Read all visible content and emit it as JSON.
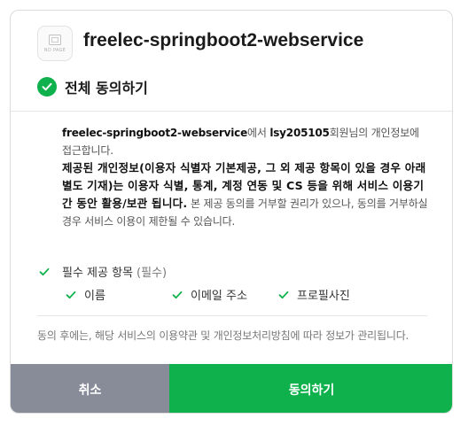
{
  "app": {
    "logo_text": "NO PAGE",
    "name": "freelec-springboot2-webservice"
  },
  "agree_all": {
    "label": "전체 동의하기",
    "checked": true
  },
  "consent": {
    "app_name": "freelec-springboot2-webservice",
    "text_1": "에서 ",
    "user_id": "lsy205105",
    "text_2": "회원님의 개인정보에 접근합니다.",
    "strong_text": "제공된 개인정보(이용자 식별자 기본제공, 그 외 제공 항목이 있을 경우 아래 별도 기재)는 이용자 식별, 통계, 계정 연동 및 CS 등을 위해 서비스 이용기간 동안 활용/보관 됩니다.",
    "text_3": " 본 제공 동의를 거부할 권리가 있으나, 동의를 거부하실 경우 서비스 이용이 제한될 수 있습니다."
  },
  "required": {
    "label": "필수 제공 항목",
    "tag": "(필수)",
    "items": [
      "이름",
      "이메일 주소",
      "프로필사진"
    ]
  },
  "notice": "동의 후에는, 해당 서비스의 이용약관 및 개인정보처리방침에 따라 정보가 관리됩니다.",
  "buttons": {
    "cancel": "취소",
    "agree": "동의하기"
  },
  "colors": {
    "accent": "#0eb14b",
    "cancel": "#888c99"
  }
}
